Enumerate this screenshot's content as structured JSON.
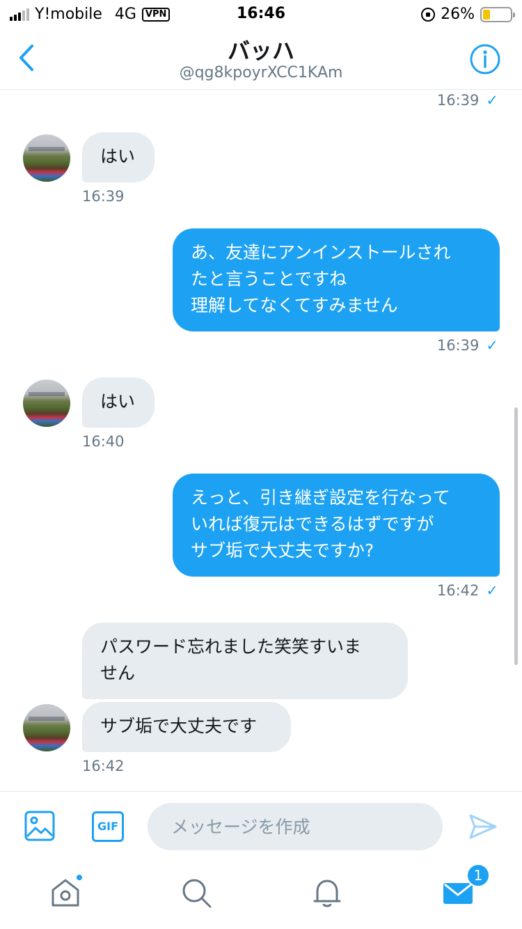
{
  "status_bar": {
    "carrier": "Y!mobile",
    "network": "4G",
    "vpn": "VPN",
    "time": "16:46",
    "battery": "26%",
    "battery_level": 0.26
  },
  "header": {
    "title": "バッハ",
    "handle": "@qg8kpoyrXCC1KAm"
  },
  "messages": [
    {
      "time": "16:39",
      "check": "✓"
    },
    {
      "text": "はい",
      "time": "16:39"
    },
    {
      "lines": [
        "あ、友達にアンインストールされ",
        "たと言うことですね",
        "理解してなくてすみません"
      ],
      "time": "16:39",
      "check": "✓"
    },
    {
      "text": "はい",
      "time": "16:40"
    },
    {
      "lines": [
        "えっと、引き継ぎ設定を行なって",
        "いれば復元はできるはずですが",
        "サブ垢で大丈夫ですか?"
      ],
      "time": "16:42",
      "check": "✓"
    },
    {
      "lines": [
        "パスワード忘れました笑笑すいま",
        "せん"
      ]
    },
    {
      "text": "サブ垢で大丈夫です",
      "time": "16:42"
    }
  ],
  "composer": {
    "gif_label": "GIF",
    "placeholder": "メッセージを作成"
  },
  "tabbar": {
    "dm_badge": "1"
  },
  "colors": {
    "accent": "#1da1f2",
    "incoming_bubble": "#e6ecf0",
    "secondary_text": "#657786"
  }
}
